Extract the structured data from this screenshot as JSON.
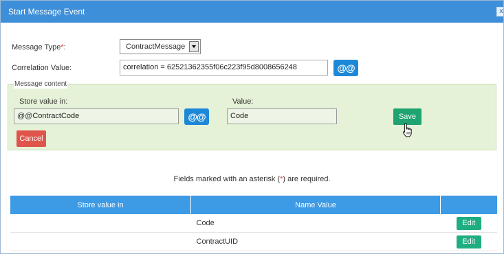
{
  "window": {
    "title": "Start Message Event",
    "close_glyph": "x"
  },
  "form": {
    "message_type_label": "Message Type",
    "required_mark": "*",
    "message_type_colon": ":",
    "message_type_value": "ContractMessage",
    "correlation_label": "Correlation Value:",
    "correlation_value": "correlation = 62521362355f06c223f95d8008656248",
    "at_button_label": "@@"
  },
  "message_content": {
    "legend": "Message content",
    "store_label": "Store value in:",
    "store_value": "@@ContractCode",
    "at_button_label": "@@",
    "value_label": "Value:",
    "value_value": "Code",
    "save_label": "Save",
    "cancel_label": "Cancel"
  },
  "note": {
    "before": "Fields marked with an asterisk (",
    "asterisk": "*",
    "after": ") are required."
  },
  "table": {
    "headers": [
      "Store value in",
      "Name Value",
      ""
    ],
    "rows": [
      {
        "store": "",
        "name": "Code",
        "action": "Edit"
      },
      {
        "store": "",
        "name": "ContractUID",
        "action": "Edit"
      }
    ]
  },
  "colors": {
    "titlebar": "#3d8fda",
    "accent_blue": "#1e88d8",
    "save_green": "#1fa370",
    "cancel_red": "#e0554b",
    "panel_green": "#e6f2d8"
  }
}
